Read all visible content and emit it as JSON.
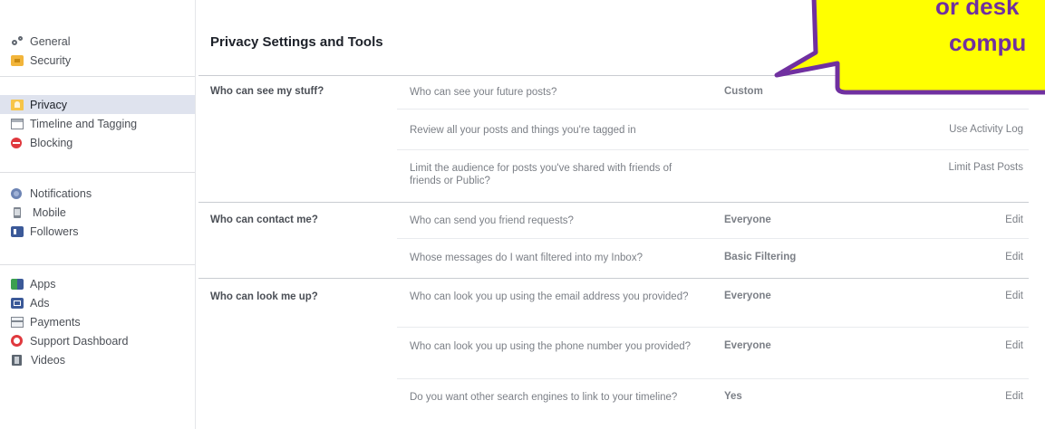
{
  "sidebar": {
    "groups": [
      [
        {
          "label": "General",
          "icon": "gear-icon"
        },
        {
          "label": "Security",
          "icon": "lock-icon"
        }
      ],
      [
        {
          "label": "Privacy",
          "icon": "privacy-lock-icon",
          "active": true
        },
        {
          "label": "Timeline and Tagging",
          "icon": "timeline-icon"
        },
        {
          "label": "Blocking",
          "icon": "block-icon"
        }
      ],
      [
        {
          "label": "Notifications",
          "icon": "globe-icon"
        },
        {
          "label": "Mobile",
          "icon": "mobile-icon"
        },
        {
          "label": "Followers",
          "icon": "followers-icon"
        }
      ],
      [
        {
          "label": "Apps",
          "icon": "apps-icon"
        },
        {
          "label": "Ads",
          "icon": "ads-icon"
        },
        {
          "label": "Payments",
          "icon": "payments-icon"
        },
        {
          "label": "Support Dashboard",
          "icon": "support-icon"
        },
        {
          "label": "Videos",
          "icon": "video-icon"
        }
      ]
    ]
  },
  "main": {
    "title": "Privacy Settings and Tools",
    "sections": [
      {
        "label": "Who can see my stuff?",
        "rows": [
          {
            "question": "Who can see your future posts?",
            "value": "Custom",
            "action": ""
          },
          {
            "question": "Review all your posts and things you're tagged in",
            "value": "",
            "action": "Use Activity Log"
          },
          {
            "question": "Limit the audience for posts you've shared with friends of friends or Public?",
            "value": "",
            "action": "Limit Past Posts"
          }
        ]
      },
      {
        "label": "Who can contact me?",
        "rows": [
          {
            "question": "Who can send you friend requests?",
            "value": "Everyone",
            "action": "Edit"
          },
          {
            "question": "Whose messages do I want filtered into my Inbox?",
            "value": "Basic Filtering",
            "action": "Edit"
          }
        ]
      },
      {
        "label": "Who can look me up?",
        "rows": [
          {
            "question": "Who can look you up using the email address you provided?",
            "value": "Everyone",
            "action": "Edit"
          },
          {
            "question": "Who can look you up using the phone number you provided?",
            "value": "Everyone",
            "action": "Edit"
          },
          {
            "question": "Do you want other search engines to link to your timeline?",
            "value": "Yes",
            "action": "Edit"
          }
        ]
      }
    ]
  },
  "callout": {
    "line1": "or desk",
    "line2": "compu",
    "fill": "#ffff00",
    "border": "#7030a0",
    "text_color": "#7030a0"
  }
}
